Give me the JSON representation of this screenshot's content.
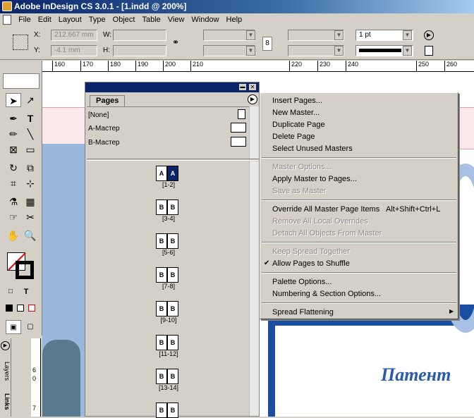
{
  "window": {
    "title": "Adobe InDesign CS 3.0.1 - [1.indd @ 200%]"
  },
  "menubar": [
    "File",
    "Edit",
    "Layout",
    "Type",
    "Object",
    "Table",
    "View",
    "Window",
    "Help"
  ],
  "control": {
    "x_label": "X:",
    "x_value": "212.667 mm",
    "y_label": "Y:",
    "y_value": "-4.1 mm",
    "w_label": "W:",
    "h_label": "H:",
    "stroke_weight": "1 pt"
  },
  "ruler": [
    "160",
    "170",
    "180",
    "190",
    "200",
    "210",
    "220",
    "230",
    "240",
    "250",
    "260"
  ],
  "vruler": [
    "6",
    "0",
    "7"
  ],
  "panel": {
    "tab": "Pages",
    "masters": [
      "[None]",
      "А-Мастер",
      "В-Мастер"
    ],
    "spreads": [
      {
        "label": "[1-2]",
        "pages": [
          "A",
          "A"
        ]
      },
      {
        "label": "[3-4]",
        "pages": [
          "B",
          "B"
        ]
      },
      {
        "label": "[5-6]",
        "pages": [
          "B",
          "B"
        ]
      },
      {
        "label": "[7-8]",
        "pages": [
          "B",
          "B"
        ]
      },
      {
        "label": "[9-10]",
        "pages": [
          "B",
          "B"
        ]
      },
      {
        "label": "[11-12]",
        "pages": [
          "B",
          "B"
        ]
      },
      {
        "label": "[13-14]",
        "pages": [
          "B",
          "B"
        ]
      },
      {
        "label": "",
        "pages": [
          "B",
          "B"
        ]
      }
    ]
  },
  "side_tabs": {
    "layers": "Layers",
    "links": "Links"
  },
  "menu": {
    "insert_pages": "Insert Pages...",
    "new_master": "New Master...",
    "duplicate_page": "Duplicate Page",
    "delete_page": "Delete Page",
    "select_unused": "Select Unused Masters",
    "master_options": "Master Options...",
    "apply_master": "Apply Master to Pages...",
    "save_as_master": "Save as Master",
    "override_all": "Override All Master Page Items",
    "override_shortcut": "Alt+Shift+Ctrl+L",
    "remove_overrides": "Remove All Local Overrides",
    "detach_all": "Detach All Objects From Master",
    "keep_spread": "Keep Spread Together",
    "allow_shuffle": "Allow Pages to Shuffle",
    "palette_options": "Palette Options...",
    "numbering": "Numbering & Section Options...",
    "spread_flattening": "Spread Flattening"
  },
  "doc_text": "Патент"
}
